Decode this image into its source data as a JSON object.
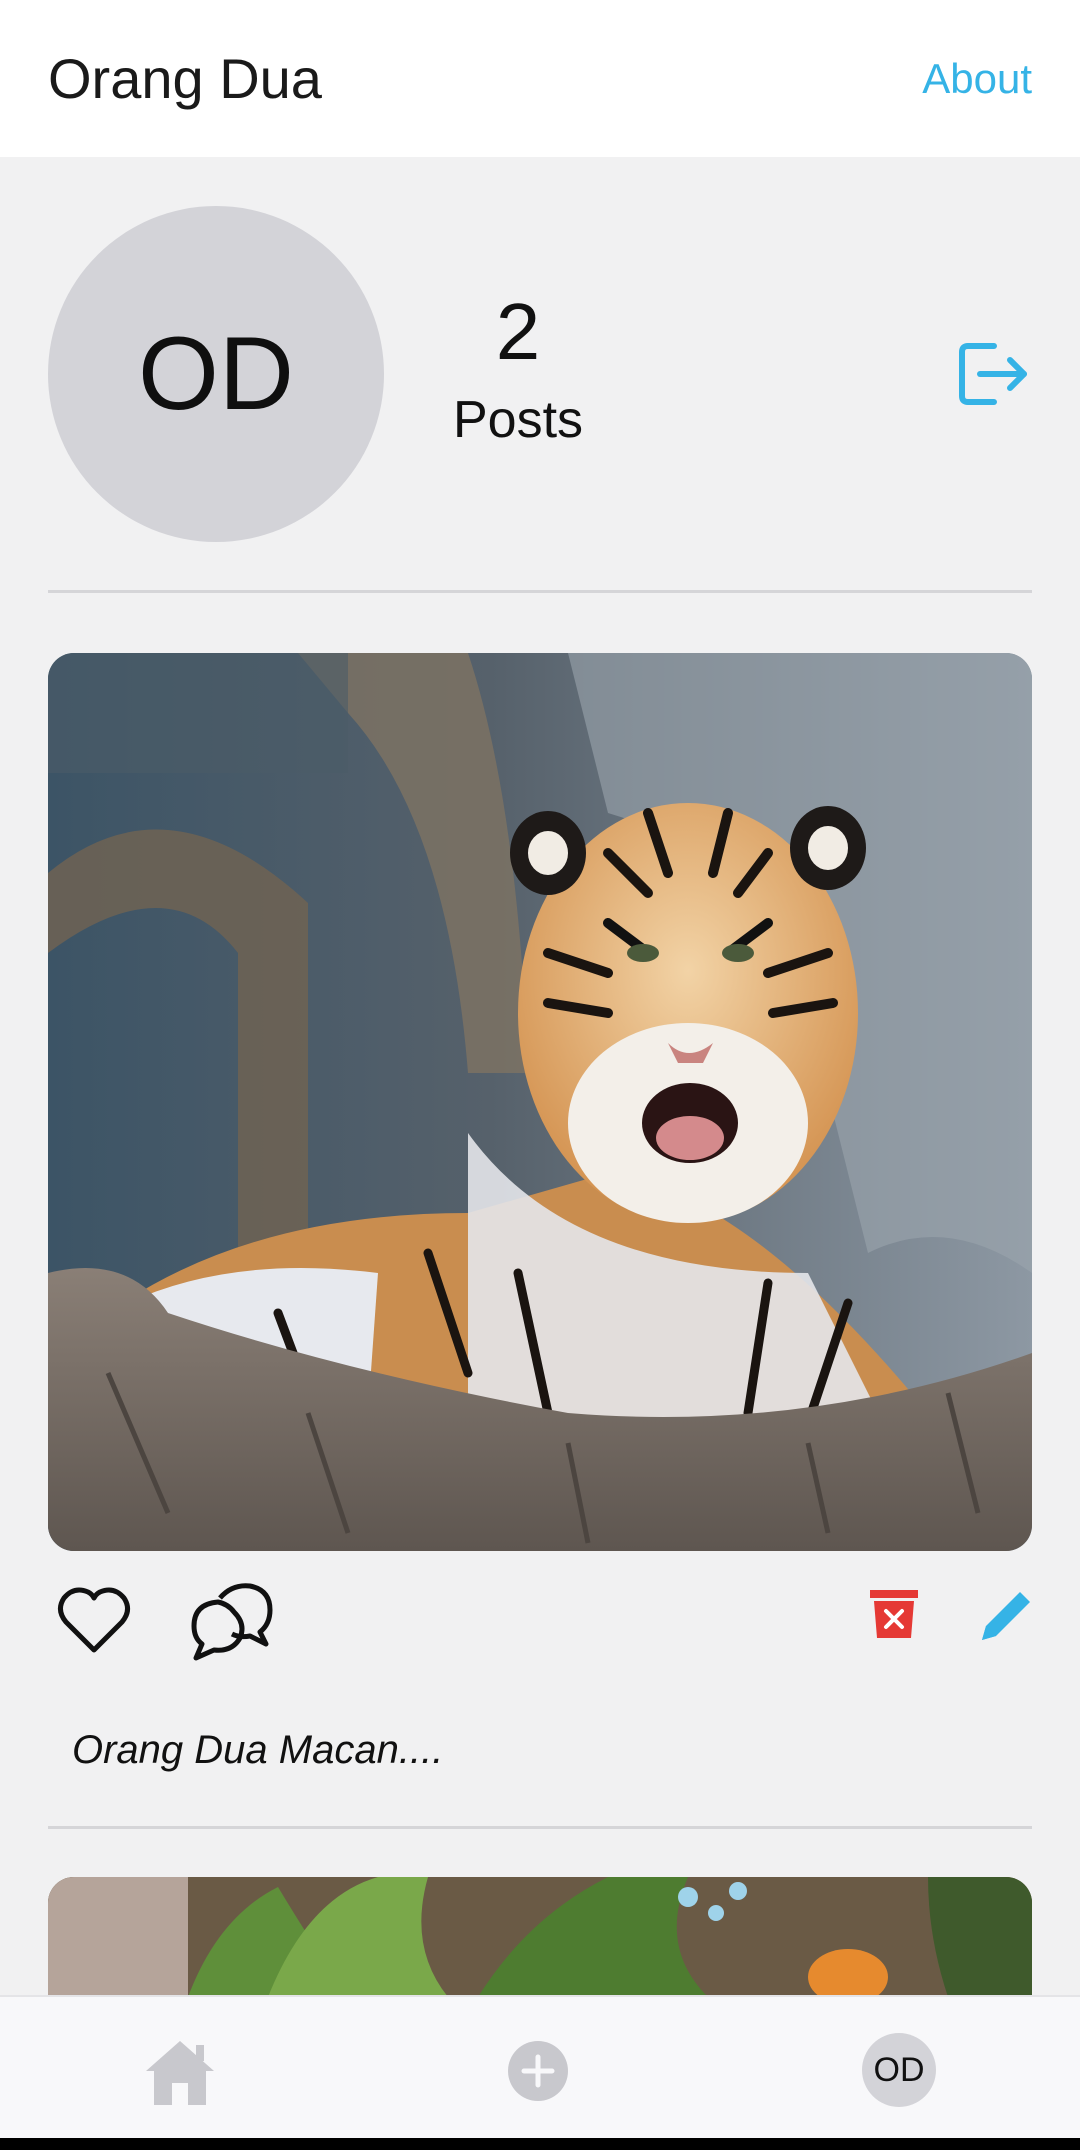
{
  "header": {
    "title": "Orang Dua",
    "about_label": "About"
  },
  "profile": {
    "initials": "OD",
    "post_count": "2",
    "posts_label": "Posts",
    "logout_icon": "logout-icon"
  },
  "posts": [
    {
      "image_alt": "tiger",
      "author": "Orang Dua",
      "caption": "Macan....",
      "actions": {
        "like_icon": "heart-outline-icon",
        "comment_icon": "chat-bubbles-icon",
        "delete_icon": "trash-icon",
        "edit_icon": "pencil-icon"
      }
    }
  ],
  "bottom_nav": {
    "home_icon": "home-icon",
    "add_icon": "plus-circle-icon",
    "profile_initials": "OD"
  },
  "colors": {
    "accent": "#35b3e6",
    "delete": "#e53935",
    "avatar_bg": "#d3d3d8",
    "background": "#f1f1f2"
  }
}
